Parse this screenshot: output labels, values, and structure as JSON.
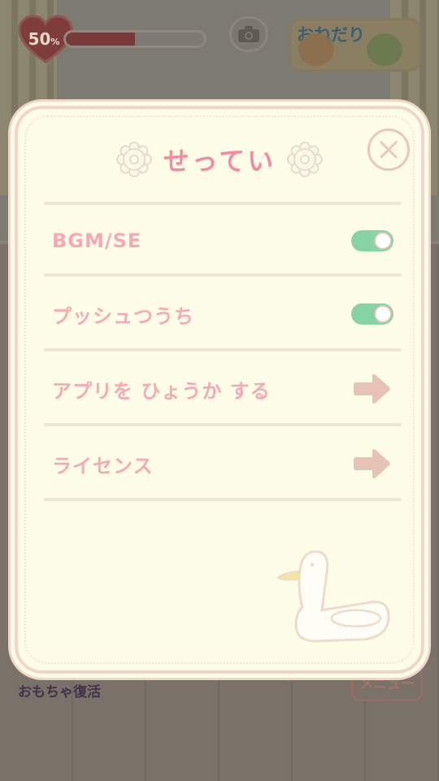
{
  "hud": {
    "love_value": "50",
    "love_unit": "%",
    "love_fraction": 0.5,
    "onedari_label": "おねだり",
    "toy_revive_label": "おもちゃ復活",
    "menu_label": "メニュー"
  },
  "dialog": {
    "title": "せってい",
    "rows": [
      {
        "label": "BGM/SE",
        "control": "toggle",
        "on": true
      },
      {
        "label": "プッシュつうち",
        "control": "toggle",
        "on": true
      },
      {
        "label": "アプリを ひょうか する",
        "control": "arrow"
      },
      {
        "label": "ライセンス",
        "control": "arrow"
      }
    ]
  },
  "colors": {
    "dialog_bg": "#fefde8",
    "dialog_border": "#efd6c9",
    "title_pink": "#f48aa4",
    "label_pink": "#f7a8b7",
    "toggle_green": "#86d3a3",
    "arrow_tan": "#e6c3b4",
    "close_border": "#ebc5c0"
  },
  "icons": {
    "camera": "camera-icon",
    "heart": "heart-icon",
    "gear": "gear-icon",
    "close": "close-icon",
    "arrow": "arrow-right-icon",
    "duck": "duck-float-illustration"
  }
}
